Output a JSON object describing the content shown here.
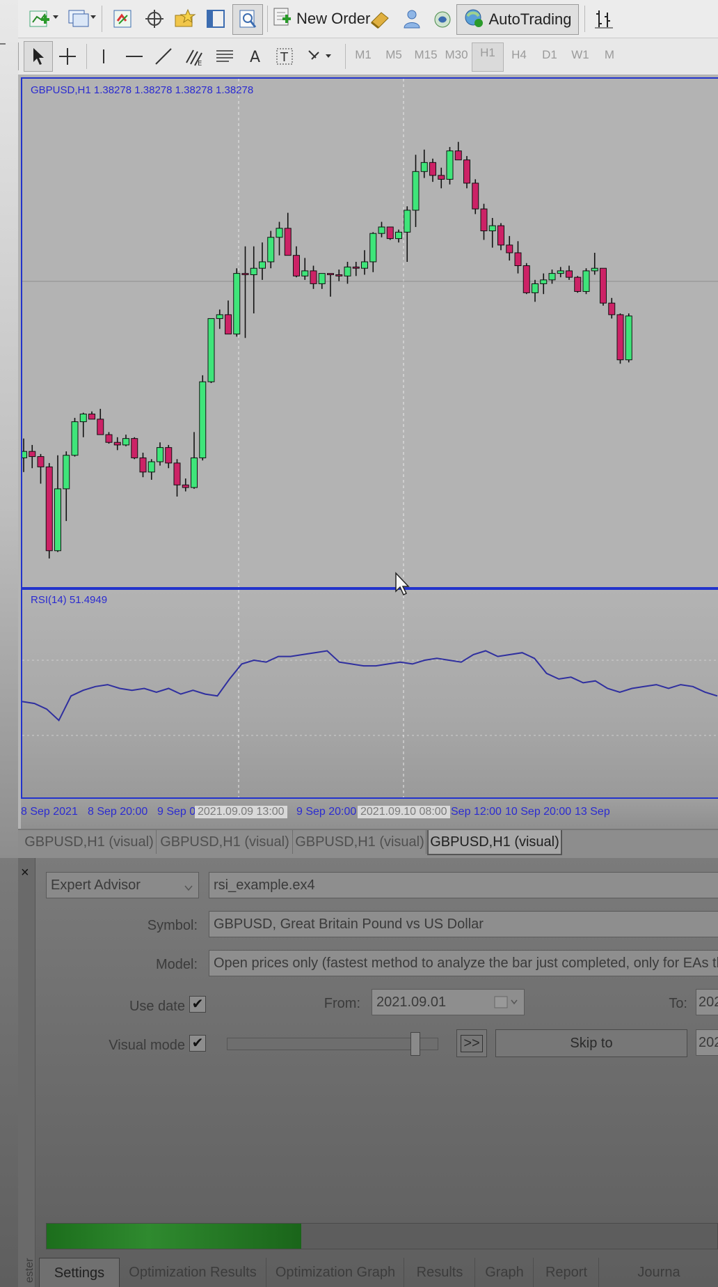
{
  "toolbar": {
    "new_order_label": "New Order",
    "autotrading_label": "AutoTrading",
    "timeframes": [
      "M1",
      "M5",
      "M15",
      "M30",
      "H1",
      "H4",
      "D1",
      "W1"
    ],
    "active_timeframe": "H1",
    "icons": [
      "new-chart-icon",
      "profiles-icon",
      "market-watch-icon",
      "navigator-icon",
      "favorites-icon",
      "data-window-icon",
      "tester-icon",
      "new-order-icon",
      "metaeditor-icon",
      "signals-icon",
      "options-icon",
      "autotrading-icon",
      "chart-period-icon",
      "cursor-icon",
      "crosshair-icon",
      "vertical-line-icon",
      "horizontal-line-icon",
      "trendline-icon",
      "fibonacci-icon",
      "channels-icon",
      "text-icon",
      "text-label-icon",
      "arrows-icon"
    ]
  },
  "chart": {
    "main_label": "GBPUSD,H1  1.38278 1.38278 1.38278 1.38278",
    "rsi_label": "RSI(14) 51.4949",
    "time_axis": [
      "8 Sep 2021",
      "8 Sep 20:00",
      "9 Sep 0",
      "2021.09.09 13:00",
      "9 Sep 20:00",
      "2021.09.10 08:00",
      "Sep 12:00",
      "10 Sep 20:00",
      "13 Sep"
    ],
    "colors": {
      "bull": "#3fe57a",
      "bear": "#cc2266",
      "frame": "#2233cc",
      "rsi_line": "#2f2f9f"
    }
  },
  "chart_data": {
    "type": "candlestick",
    "symbol": "GBPUSD",
    "timeframe": "H1",
    "candles": [
      {
        "o": 42.0,
        "h": 49.5,
        "l": 36.5,
        "c": 44.5
      },
      {
        "o": 44.5,
        "h": 47.0,
        "l": 38.0,
        "c": 42.5
      },
      {
        "o": 42.5,
        "h": 43.5,
        "l": 32.0,
        "c": 38.5
      },
      {
        "o": 38.5,
        "h": 40.0,
        "l": 3.0,
        "c": 6.0
      },
      {
        "o": 6.0,
        "h": 43.0,
        "l": 5.5,
        "c": 30.0
      },
      {
        "o": 30.0,
        "h": 44.5,
        "l": 17.5,
        "c": 43.0
      },
      {
        "o": 43.0,
        "h": 57.5,
        "l": 42.5,
        "c": 56.0
      },
      {
        "o": 56.0,
        "h": 59.5,
        "l": 50.0,
        "c": 59.0
      },
      {
        "o": 59.0,
        "h": 60.0,
        "l": 57.5,
        "c": 57.0
      },
      {
        "o": 57.0,
        "h": 61.0,
        "l": 55.5,
        "c": 51.0
      },
      {
        "o": 51.0,
        "h": 52.0,
        "l": 47.5,
        "c": 48.0
      },
      {
        "o": 48.0,
        "h": 50.0,
        "l": 45.0,
        "c": 47.0
      },
      {
        "o": 47.0,
        "h": 51.0,
        "l": 46.5,
        "c": 49.5
      },
      {
        "o": 49.5,
        "h": 50.0,
        "l": 41.5,
        "c": 42.0
      },
      {
        "o": 42.0,
        "h": 44.0,
        "l": 34.5,
        "c": 36.5
      },
      {
        "o": 36.5,
        "h": 41.5,
        "l": 33.5,
        "c": 40.5
      },
      {
        "o": 40.5,
        "h": 48.0,
        "l": 39.0,
        "c": 46.0
      },
      {
        "o": 46.0,
        "h": 47.0,
        "l": 38.0,
        "c": 40.0
      },
      {
        "o": 40.0,
        "h": 41.5,
        "l": 27.0,
        "c": 31.5
      },
      {
        "o": 31.5,
        "h": 34.0,
        "l": 29.0,
        "c": 30.5
      },
      {
        "o": 30.5,
        "h": 52.0,
        "l": 30.0,
        "c": 42.0
      },
      {
        "o": 42.0,
        "h": 74.0,
        "l": 41.0,
        "c": 71.5
      },
      {
        "o": 71.5,
        "h": 96.0,
        "l": 71.0,
        "c": 96.0
      },
      {
        "o": 96.0,
        "h": 99.5,
        "l": 92.0,
        "c": 97.5
      },
      {
        "o": 97.5,
        "h": 103.0,
        "l": 91.0,
        "c": 90.0
      },
      {
        "o": 90.0,
        "h": 115.5,
        "l": 89.0,
        "c": 113.5
      },
      {
        "o": 113.5,
        "h": 124.0,
        "l": 88.5,
        "c": 113.0
      },
      {
        "o": 113.0,
        "h": 124.0,
        "l": 98.0,
        "c": 115.5
      },
      {
        "o": 115.5,
        "h": 125.5,
        "l": 111.0,
        "c": 118.0
      },
      {
        "o": 118.0,
        "h": 130.0,
        "l": 115.5,
        "c": 127.5
      },
      {
        "o": 127.5,
        "h": 133.5,
        "l": 120.5,
        "c": 131.0
      },
      {
        "o": 131.0,
        "h": 137.0,
        "l": 120.5,
        "c": 120.5
      },
      {
        "o": 120.5,
        "h": 124.0,
        "l": 112.0,
        "c": 112.5
      },
      {
        "o": 112.5,
        "h": 119.5,
        "l": 111.0,
        "c": 114.5
      },
      {
        "o": 114.5,
        "h": 116.5,
        "l": 107.5,
        "c": 109.5
      },
      {
        "o": 109.5,
        "h": 112.5,
        "l": 107.5,
        "c": 113.5
      },
      {
        "o": 113.5,
        "h": 113.5,
        "l": 104.5,
        "c": 113.0
      },
      {
        "o": 113.0,
        "h": 115.0,
        "l": 110.5,
        "c": 112.5
      },
      {
        "o": 112.5,
        "h": 118.0,
        "l": 109.5,
        "c": 116.0
      },
      {
        "o": 116.0,
        "h": 118.0,
        "l": 112.5,
        "c": 115.5
      },
      {
        "o": 115.5,
        "h": 122.5,
        "l": 113.0,
        "c": 118.0
      },
      {
        "o": 118.0,
        "h": 129.5,
        "l": 114.0,
        "c": 129.0
      },
      {
        "o": 129.0,
        "h": 133.5,
        "l": 127.5,
        "c": 131.5
      },
      {
        "o": 131.5,
        "h": 131.5,
        "l": 126.5,
        "c": 127.0
      },
      {
        "o": 127.0,
        "h": 130.5,
        "l": 125.5,
        "c": 129.5
      },
      {
        "o": 129.5,
        "h": 139.5,
        "l": 118.0,
        "c": 138.0
      },
      {
        "o": 138.0,
        "h": 159.5,
        "l": 131.5,
        "c": 153.0
      },
      {
        "o": 153.0,
        "h": 161.5,
        "l": 150.5,
        "c": 156.5
      },
      {
        "o": 156.5,
        "h": 158.0,
        "l": 149.0,
        "c": 151.5
      },
      {
        "o": 151.5,
        "h": 154.5,
        "l": 146.5,
        "c": 150.0
      },
      {
        "o": 150.0,
        "h": 162.5,
        "l": 148.0,
        "c": 161.0
      },
      {
        "o": 161.0,
        "h": 164.5,
        "l": 157.5,
        "c": 157.5
      },
      {
        "o": 157.5,
        "h": 159.0,
        "l": 146.5,
        "c": 148.5
      },
      {
        "o": 148.5,
        "h": 150.0,
        "l": 136.5,
        "c": 138.5
      },
      {
        "o": 138.5,
        "h": 140.5,
        "l": 126.5,
        "c": 130.0
      },
      {
        "o": 130.0,
        "h": 135.0,
        "l": 123.5,
        "c": 132.0
      },
      {
        "o": 132.0,
        "h": 133.0,
        "l": 122.5,
        "c": 124.5
      },
      {
        "o": 124.5,
        "h": 128.0,
        "l": 118.5,
        "c": 121.5
      },
      {
        "o": 121.5,
        "h": 126.0,
        "l": 113.5,
        "c": 116.5
      },
      {
        "o": 116.5,
        "h": 117.5,
        "l": 105.5,
        "c": 106.0
      },
      {
        "o": 106.0,
        "h": 111.0,
        "l": 102.5,
        "c": 109.5
      },
      {
        "o": 109.5,
        "h": 113.5,
        "l": 105.5,
        "c": 111.0
      },
      {
        "o": 111.0,
        "h": 115.0,
        "l": 109.5,
        "c": 113.5
      },
      {
        "o": 113.5,
        "h": 116.0,
        "l": 112.0,
        "c": 114.5
      },
      {
        "o": 114.5,
        "h": 116.5,
        "l": 111.0,
        "c": 112.0
      },
      {
        "o": 112.0,
        "h": 112.5,
        "l": 106.0,
        "c": 106.5
      },
      {
        "o": 106.5,
        "h": 115.5,
        "l": 105.5,
        "c": 114.5
      },
      {
        "o": 114.5,
        "h": 121.5,
        "l": 113.0,
        "c": 115.5
      },
      {
        "o": 115.5,
        "h": 115.5,
        "l": 101.0,
        "c": 102.0
      },
      {
        "o": 102.0,
        "h": 104.0,
        "l": 96.0,
        "c": 97.5
      },
      {
        "o": 97.5,
        "h": 98.0,
        "l": 78.5,
        "c": 80.0
      },
      {
        "o": 80.0,
        "h": 98.0,
        "l": 79.0,
        "c": 97.0
      }
    ],
    "rsi": {
      "name": "RSI(14)",
      "last_value": 51.4949,
      "levels": [
        70,
        30
      ],
      "ylim": [
        0,
        100
      ],
      "values": [
        48,
        47,
        44,
        38,
        51,
        54,
        56,
        57,
        55,
        54,
        55,
        53,
        55,
        52,
        54,
        52,
        51,
        60,
        68,
        70,
        69,
        72,
        72,
        73,
        74,
        75,
        69,
        68,
        67,
        67,
        68,
        69,
        68,
        70,
        71,
        70,
        69,
        73,
        75,
        72,
        73,
        74,
        71,
        63,
        60,
        61,
        58,
        59,
        55,
        53,
        55,
        56,
        57,
        55,
        57,
        56,
        53,
        51
      ]
    }
  },
  "tester": {
    "close_label": "×",
    "panel_label": "ester",
    "type": "Expert Advisor",
    "expert_file": "rsi_example.ex4",
    "symbol_label": "Symbol:",
    "symbol_value": "GBPUSD, Great Britain Pound vs US Dollar",
    "model_label": "Model:",
    "model_value": "Open prices only (fastest method to analyze the bar just completed, only for EAs that",
    "use_date_label": "Use date",
    "use_date_checked": true,
    "from_label": "From:",
    "from_value": "2021.09.01",
    "to_label": "To:",
    "to_value": "202",
    "visual_mode_label": "Visual mode",
    "visual_mode_checked": true,
    "visual_speed": 0.93,
    "fast_forward_label": ">>",
    "skip_to_label": "Skip to",
    "skip_to_value": "202",
    "progress": 0.38,
    "bottom_tabs": [
      "Settings",
      "Optimization Results",
      "Optimization Graph",
      "Results",
      "Graph",
      "Report",
      "Journa"
    ]
  },
  "chart_tabs": [
    "GBPUSD,H1 (visual)",
    "GBPUSD,H1 (visual)",
    "GBPUSD,H1 (visual)",
    "GBPUSD,H1 (visual)"
  ]
}
